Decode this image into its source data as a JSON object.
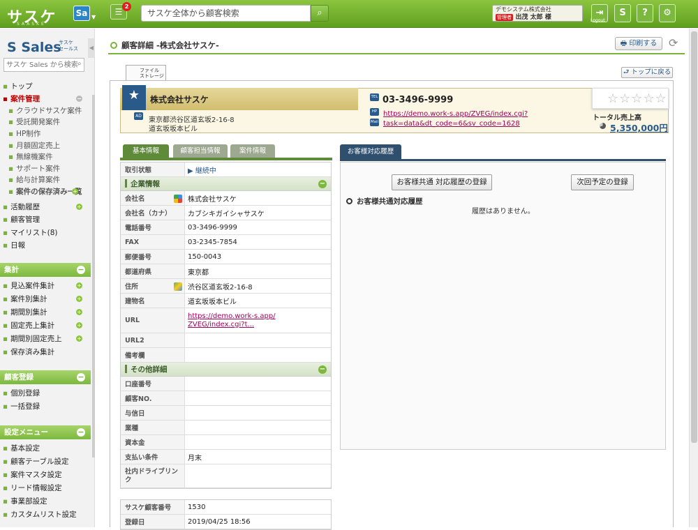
{
  "header": {
    "logo": "サスケ",
    "logo_sub": "SAASKE",
    "sa_badge": "Sa",
    "notif_count": "2",
    "search_placeholder": "サスケ全体から顧客検索",
    "user_company": "デモシステム株式会社",
    "user_role": "管理者",
    "user_name": "出茂 太郎 様",
    "logout_label": "Logout"
  },
  "sidebar": {
    "product": "Sales",
    "product_sub1": "サスケ",
    "product_sub2": "セールス",
    "search_placeholder": "サスケ Sales から検索",
    "items": [
      {
        "label": "トップ"
      },
      {
        "label": "案件管理"
      },
      {
        "label": "クラウドサスケ案件"
      },
      {
        "label": "受託開発案件"
      },
      {
        "label": "HP制作"
      },
      {
        "label": "月額固定売上"
      },
      {
        "label": "無線機案件"
      },
      {
        "label": "サポート案件"
      },
      {
        "label": "給与計算案件"
      },
      {
        "label": "案件の保存済み一覧"
      },
      {
        "label": "活動履歴"
      },
      {
        "label": "顧客管理"
      },
      {
        "label": "マイリスト(8)"
      },
      {
        "label": "日報"
      }
    ],
    "sections": [
      {
        "title": "集計",
        "items": [
          "見込案件集計",
          "案件別集計",
          "期間別集計",
          "固定売上集計",
          "期間別固定売上",
          "保存済み集計"
        ]
      },
      {
        "title": "顧客登録",
        "items": [
          "個別登録",
          "一括登録"
        ]
      },
      {
        "title": "設定メニュー",
        "items": [
          "基本設定",
          "顧客テーブル設定",
          "案件マスタ設定",
          "リード情報設定",
          "事業部設定",
          "カスタムリスト設定"
        ]
      }
    ]
  },
  "main": {
    "title": "顧客詳細 -株式会社サスケ-",
    "print_label": "印刷する",
    "file_tab_1": "ファイル",
    "file_tab_2": "ストレージ",
    "top_return": "トップに戻る"
  },
  "customer": {
    "name": "株式会社サスケ",
    "addr_icon": "AD",
    "address1": "東京都渋谷区道玄坂2-16-8",
    "address2": "道玄坂坂本ビル",
    "tel_icon": "TEL",
    "hp_icon": "HP",
    "mail_icon": "Mail",
    "tel": "03-3496-9999",
    "url_line1": "https://demo.work-s.app/ZVEG/index.cgi?",
    "url_line2": "task=data&dt_code=6&sv_code=1628",
    "rating_stars": 0,
    "total_sales_label": "トータル売上高",
    "total_sales": "5,350,000円"
  },
  "tabs": {
    "basic": "基本情報",
    "contact": "顧客担当情報",
    "deal": "案件情報",
    "history": "お客様対応履歴"
  },
  "info": {
    "status_label": "取引状態",
    "status_value": "▶ 継続中",
    "company_section": "企業情報",
    "rows": [
      {
        "label": "会社名",
        "value": "株式会社サスケ"
      },
      {
        "label": "会社名（カナ）",
        "value": "カブシキガイシャサスケ"
      },
      {
        "label": "電話番号",
        "value": "03-3496-9999"
      },
      {
        "label": "FAX",
        "value": "03-2345-7854"
      },
      {
        "label": "郵便番号",
        "value": "150-0043"
      },
      {
        "label": "都道府県",
        "value": "東京都"
      },
      {
        "label": "住所",
        "value": "渋谷区道玄坂2-16-8"
      },
      {
        "label": "建物名",
        "value": "道玄坂坂本ビル"
      },
      {
        "label": "URL",
        "value": "https://demo.work-s.app/ZVEG/index.cgi?t..."
      },
      {
        "label": "URL2",
        "value": ""
      },
      {
        "label": "備考欄",
        "value": ""
      }
    ],
    "other_section": "その他詳細",
    "other_rows": [
      {
        "label": "口座番号",
        "value": ""
      },
      {
        "label": "顧客NO.",
        "value": ""
      },
      {
        "label": "与信日",
        "value": ""
      },
      {
        "label": "業種",
        "value": ""
      },
      {
        "label": "資本金",
        "value": ""
      },
      {
        "label": "支払い条件",
        "value": "月末"
      },
      {
        "label": "社内ドライブリンク",
        "value": ""
      }
    ],
    "footer_rows": [
      {
        "label": "サスケ顧客番号",
        "value": "1530"
      },
      {
        "label": "登録日",
        "value": "2019/04/25 18:56"
      }
    ]
  },
  "history": {
    "register_btn": "お客様共通 対応履歴の登録",
    "schedule_btn": "次回予定の登録",
    "section_title": "お客様共通対応履歴",
    "empty_text": "履歴はありません。"
  }
}
